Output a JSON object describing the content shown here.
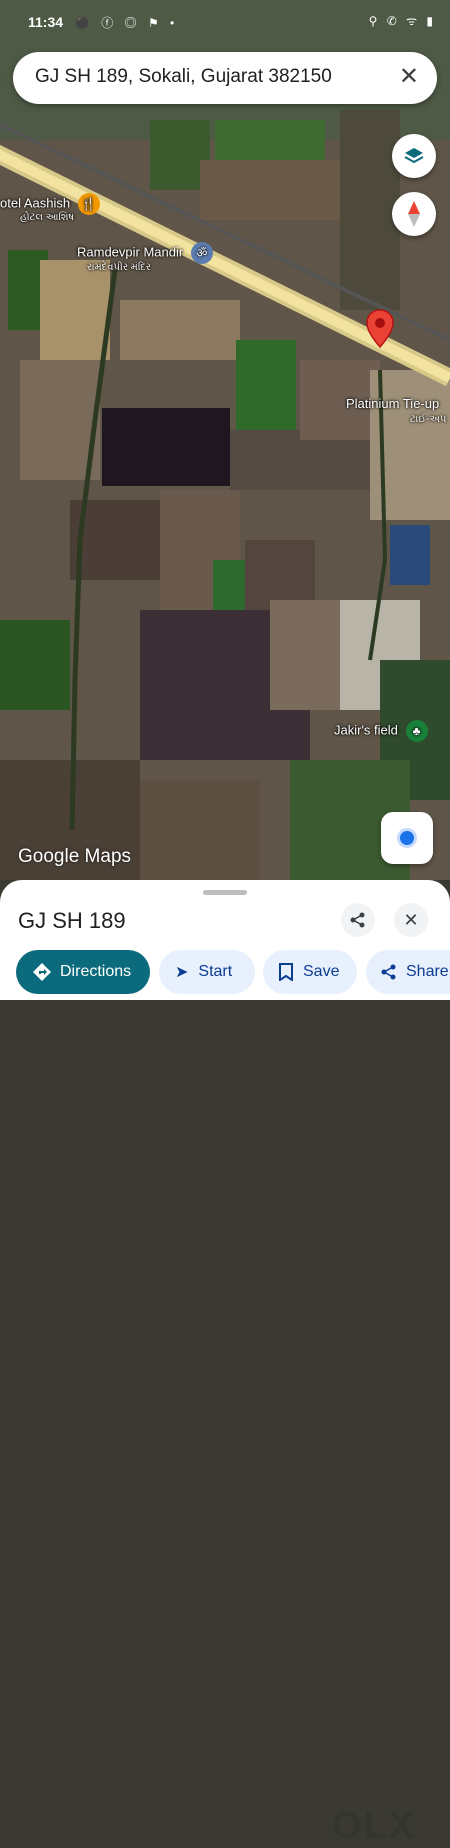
{
  "status": {
    "time": "11:34",
    "left_icons": "⚫ ⓕ ◎ ⚑ •",
    "right_icons": "⚲ ✆ ᯤ ▮"
  },
  "search": {
    "address": "GJ SH 189, Sokali, Gujarat 382150",
    "close_icon": "✕"
  },
  "map": {
    "places": [
      {
        "name": "otel Aashish",
        "sub": "હોટલ આશિષ"
      },
      {
        "name": "Ramdevpir Mandir",
        "sub": "રામદેવપીર મંદિર"
      },
      {
        "name": "Platinium Tie-up",
        "sub": "ટાઈ-અપ"
      },
      {
        "name": "Jakir's field"
      }
    ],
    "brand": "Google Maps"
  },
  "sheet": {
    "title": "GJ SH 189",
    "actions": {
      "directions": "Directions",
      "start": "Start",
      "save": "Save",
      "share": "Share"
    }
  },
  "colors": {
    "accent": "#0b6b7d",
    "pin": "#ea4335",
    "chip_bg": "#e8f0fe"
  },
  "watermark": "OLX"
}
